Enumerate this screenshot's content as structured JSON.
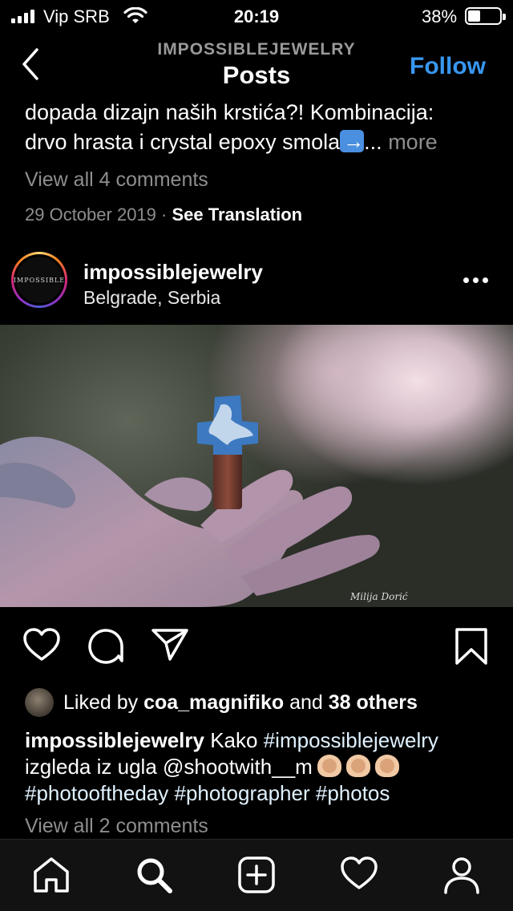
{
  "status_bar": {
    "carrier": "Vip SRB",
    "time": "20:19",
    "battery": "38%",
    "battery_level": 0.38,
    "icons": [
      "signal-icon",
      "wifi-icon",
      "battery-icon"
    ]
  },
  "header": {
    "subtitle": "IMPOSSIBLEJEWELRY",
    "title": "Posts",
    "follow_label": "Follow",
    "back_icon": "chevron-left-icon",
    "accent_color": "#3897f0"
  },
  "previous_post": {
    "caption_line1": "dopada dizajn naših krstića?! Kombinacija:",
    "caption_line2": "drvo hrasta i crystal epoxy smola",
    "caption_ellipsis": "...",
    "more_label": "more",
    "view_comments": "View all 4 comments",
    "date": "29 October 2019",
    "separator": "·",
    "see_translation": "See Translation"
  },
  "post": {
    "avatar_text": "IMPOSSIBLE",
    "username": "impossiblejewelry",
    "location": "Belgrade, Serbia",
    "image_signature": "Milija Dorić",
    "likes": {
      "prefix": "Liked by",
      "liker": "coa_magnifiko",
      "conjunction": "and",
      "others": "38 others"
    },
    "caption": {
      "username": "impossiblejewelry",
      "text1": "Kako",
      "hashtag1": "#impossiblejewelry",
      "text2": "izgleda iz ugla @shootwith__m",
      "hashtags_line": "#photooftheday #photographer #photos"
    },
    "view_comments": "View all 2 comments"
  },
  "actions": [
    "heart-icon",
    "comment-icon",
    "share-icon",
    "bookmark-icon"
  ],
  "tab_bar": [
    "home-icon",
    "search-icon",
    "new-post-icon",
    "activity-icon",
    "profile-icon"
  ]
}
